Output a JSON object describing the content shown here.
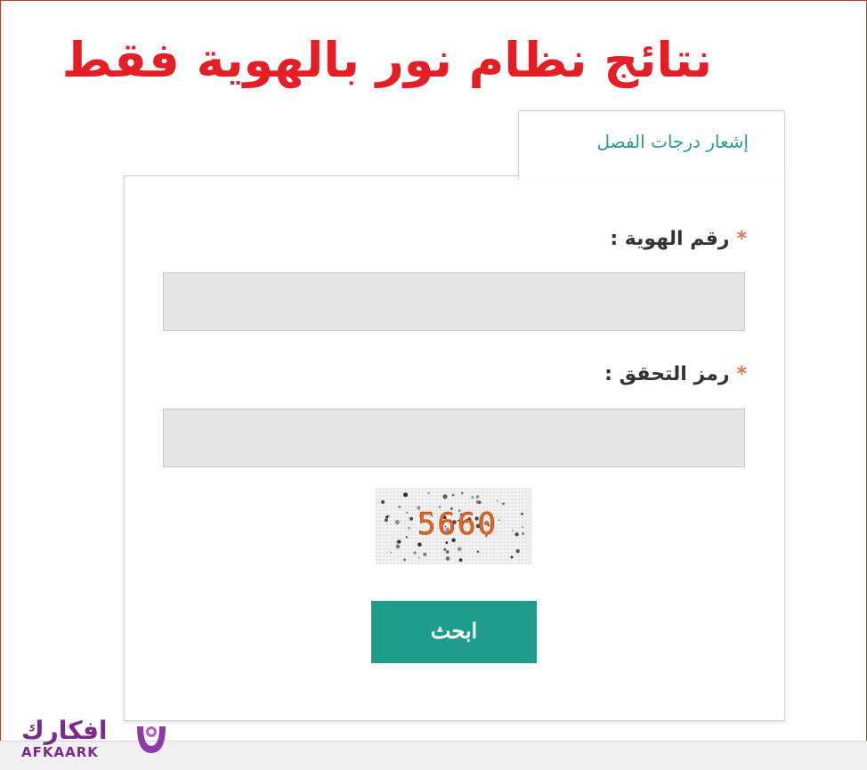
{
  "headline": "نتائج نظام نور بالهوية فقط",
  "tab": {
    "label": "إشعار درجات الفصل"
  },
  "form": {
    "id_label": "رقم الهوية :",
    "captcha_label": "رمز التحقق :",
    "required_mark": "*",
    "id_value": "",
    "captcha_value": "",
    "captcha_code": "5660",
    "submit_label": "ابحث"
  },
  "logo": {
    "arabic": "افكارك",
    "latin": "AFKAARK"
  },
  "colors": {
    "headline": "#e31e24",
    "tab_text": "#2a9d8f",
    "button": "#1f9c8a",
    "required": "#e8735a",
    "logo": "#7b2a8c",
    "captcha_text": "#e8661e"
  }
}
